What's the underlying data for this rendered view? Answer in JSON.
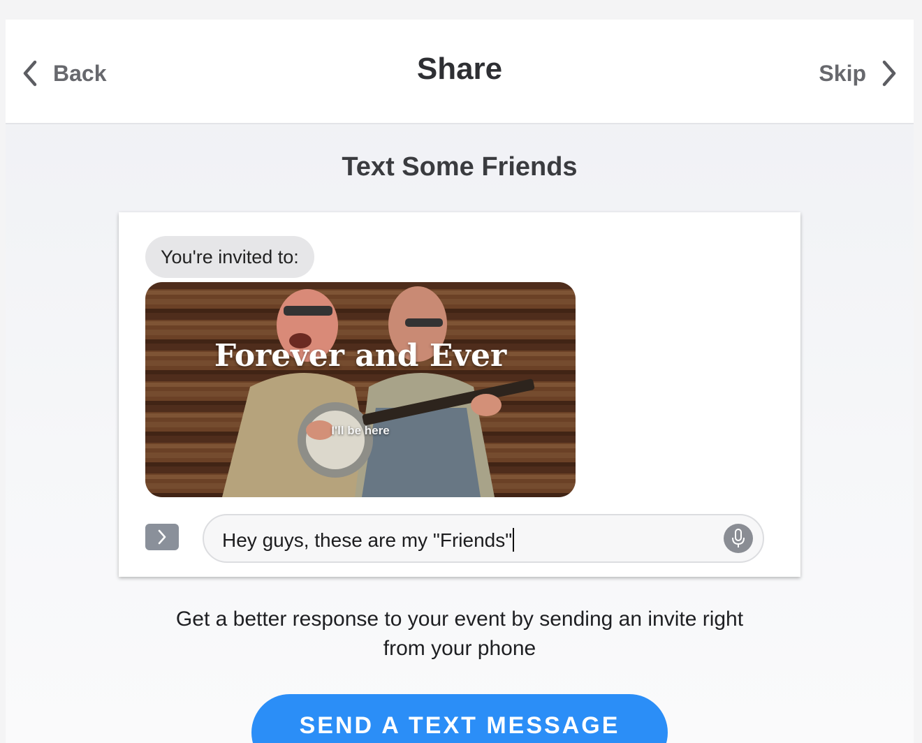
{
  "header": {
    "back_label": "Back",
    "title": "Share",
    "skip_label": "Skip"
  },
  "main": {
    "subtitle": "Text Some Friends",
    "message_preview": {
      "bubble_text": "You're invited to:",
      "media_title": "Forever and Ever",
      "media_subtitle": "I'll be here",
      "input_value": "Hey guys, these are my \"Friends\""
    },
    "info_line1": "Get a better response to your event by sending an invite right",
    "info_line2": "from your phone",
    "cta_label": "SEND A TEXT MESSAGE"
  },
  "colors": {
    "accent": "#2b8ef7",
    "header_bg": "#ffffff",
    "page_bg": "#eff0f4"
  },
  "icons": [
    "chevron-left-icon",
    "chevron-right-icon",
    "expand-chevron-icon",
    "microphone-icon"
  ]
}
